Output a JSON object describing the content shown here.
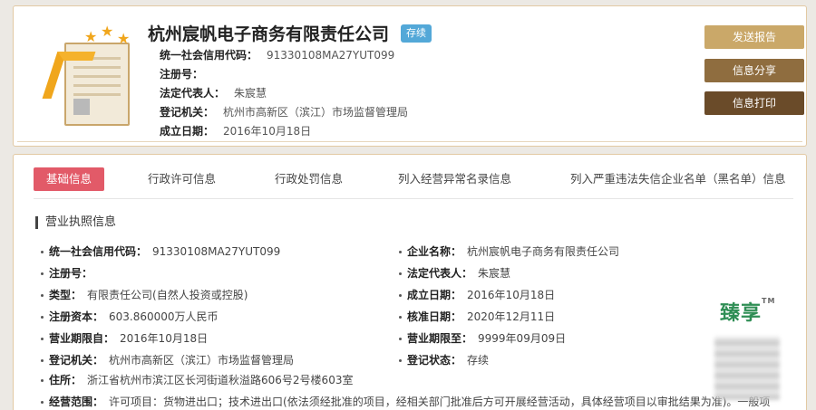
{
  "company": {
    "name": "杭州宸帆电子商务有限责任公司",
    "status": "存续",
    "summary": [
      {
        "key": "统一社会信用代码：",
        "value": "91330108MA27YUT099"
      },
      {
        "key": "注册号：",
        "value": ""
      },
      {
        "key": "法定代表人：",
        "value": "朱宸慧"
      },
      {
        "key": "登记机关：",
        "value": "杭州市高新区（滨江）市场监督管理局"
      },
      {
        "key": "成立日期：",
        "value": "2016年10月18日"
      }
    ]
  },
  "actions": {
    "report": "发送报告",
    "share": "信息分享",
    "print": "信息打印"
  },
  "tabs": [
    "基础信息",
    "行政许可信息",
    "行政处罚信息",
    "列入经营异常名录信息",
    "列入严重违法失信企业名单（黑名单）信息"
  ],
  "section": {
    "title": "营业执照信息",
    "left": [
      {
        "key": "统一社会信用代码：",
        "value": "91330108MA27YUT099"
      },
      {
        "key": "注册号：",
        "value": ""
      },
      {
        "key": "类型：",
        "value": "有限责任公司(自然人投资或控股)"
      },
      {
        "key": "注册资本：",
        "value": "603.860000万人民币"
      },
      {
        "key": "营业期限自：",
        "value": "2016年10月18日"
      },
      {
        "key": "登记机关：",
        "value": "杭州市高新区（滨江）市场监督管理局"
      },
      {
        "key": "住所：",
        "value": "浙江省杭州市滨江区长河街道秋溢路606号2号楼603室"
      },
      {
        "key": "经营范围：",
        "value": "许可项目：货物进出口；技术进出口(依法须经批准的项目，经相关部门批准后方可开展经营活动，具体经营项目以审批结果为准)。一般项"
      }
    ],
    "right": [
      {
        "key": "企业名称：",
        "value": "杭州宸帆电子商务有限责任公司"
      },
      {
        "key": "法定代表人：",
        "value": "朱宸慧"
      },
      {
        "key": "成立日期：",
        "value": "2016年10月18日"
      },
      {
        "key": "核准日期：",
        "value": "2020年12月11日"
      },
      {
        "key": "营业期限至：",
        "value": "9999年09月09日"
      },
      {
        "key": "登记状态：",
        "value": "存续"
      }
    ]
  },
  "brand": {
    "name": "臻享",
    "tm": "TM"
  }
}
